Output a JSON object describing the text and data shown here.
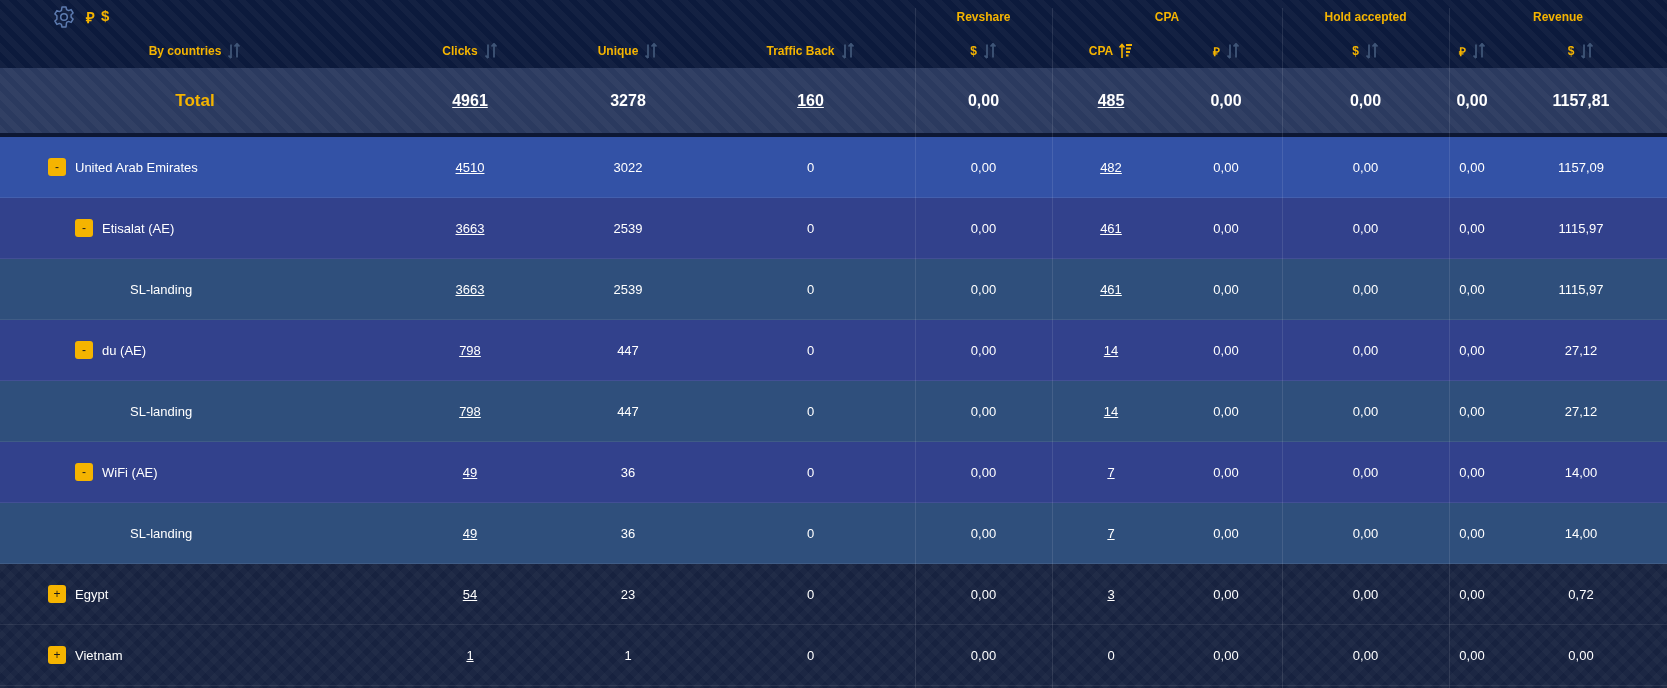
{
  "toolbar": {
    "currencies": [
      "₽",
      "$"
    ]
  },
  "columns": [
    {
      "label": "By countries",
      "sorted": false
    },
    {
      "label": "Clicks",
      "sorted": false
    },
    {
      "label": "Unique",
      "sorted": false
    },
    {
      "label": "Traffic Back",
      "sorted": false
    }
  ],
  "groups": [
    {
      "label": "Revshare",
      "columns": [
        {
          "label": "$",
          "sorted": false
        }
      ]
    },
    {
      "label": "CPA",
      "columns": [
        {
          "label": "CPA",
          "sorted": true
        },
        {
          "label": "₽",
          "sorted": false
        }
      ]
    },
    {
      "label": "Hold accepted",
      "columns": [
        {
          "label": "$",
          "sorted": false
        }
      ]
    },
    {
      "label": "Revenue",
      "columns": [
        {
          "label": "₽",
          "sorted": false
        },
        {
          "label": "$",
          "sorted": false
        }
      ]
    }
  ],
  "total": {
    "label": "Total",
    "cells": [
      {
        "text": "4961",
        "link": true
      },
      {
        "text": "3278",
        "link": false
      },
      {
        "text": "160",
        "link": true
      },
      {
        "text": "0,00",
        "link": false
      },
      {
        "text": "485",
        "link": true
      },
      {
        "text": "0,00",
        "link": false
      },
      {
        "text": "0,00",
        "link": false
      },
      {
        "text": "0,00",
        "link": false
      },
      {
        "text": "1157,81",
        "link": false
      }
    ]
  },
  "rows": [
    {
      "name": "United Arab Emirates",
      "toggle": "-",
      "expanded": true,
      "cells": [
        {
          "text": "4510",
          "link": true
        },
        {
          "text": "3022",
          "link": false
        },
        {
          "text": "0",
          "link": false
        },
        {
          "text": "0,00",
          "link": false
        },
        {
          "text": "482",
          "link": true
        },
        {
          "text": "0,00",
          "link": false
        },
        {
          "text": "0,00",
          "link": false
        },
        {
          "text": "0,00",
          "link": false
        },
        {
          "text": "1157,09",
          "link": false
        }
      ],
      "children": [
        {
          "name": "Etisalat (AE)",
          "toggle": "-",
          "expanded": true,
          "cells": [
            {
              "text": "3663",
              "link": true
            },
            {
              "text": "2539",
              "link": false
            },
            {
              "text": "0",
              "link": false
            },
            {
              "text": "0,00",
              "link": false
            },
            {
              "text": "461",
              "link": true
            },
            {
              "text": "0,00",
              "link": false
            },
            {
              "text": "0,00",
              "link": false
            },
            {
              "text": "0,00",
              "link": false
            },
            {
              "text": "1115,97",
              "link": false
            }
          ],
          "children": [
            {
              "name": "SL-landing",
              "cells": [
                {
                  "text": "3663",
                  "link": true
                },
                {
                  "text": "2539",
                  "link": false
                },
                {
                  "text": "0",
                  "link": false
                },
                {
                  "text": "0,00",
                  "link": false
                },
                {
                  "text": "461",
                  "link": true
                },
                {
                  "text": "0,00",
                  "link": false
                },
                {
                  "text": "0,00",
                  "link": false
                },
                {
                  "text": "0,00",
                  "link": false
                },
                {
                  "text": "1115,97",
                  "link": false
                }
              ]
            }
          ]
        },
        {
          "name": "du (AE)",
          "toggle": "-",
          "expanded": true,
          "cells": [
            {
              "text": "798",
              "link": true
            },
            {
              "text": "447",
              "link": false
            },
            {
              "text": "0",
              "link": false
            },
            {
              "text": "0,00",
              "link": false
            },
            {
              "text": "14",
              "link": true
            },
            {
              "text": "0,00",
              "link": false
            },
            {
              "text": "0,00",
              "link": false
            },
            {
              "text": "0,00",
              "link": false
            },
            {
              "text": "27,12",
              "link": false
            }
          ],
          "children": [
            {
              "name": "SL-landing",
              "cells": [
                {
                  "text": "798",
                  "link": true
                },
                {
                  "text": "447",
                  "link": false
                },
                {
                  "text": "0",
                  "link": false
                },
                {
                  "text": "0,00",
                  "link": false
                },
                {
                  "text": "14",
                  "link": true
                },
                {
                  "text": "0,00",
                  "link": false
                },
                {
                  "text": "0,00",
                  "link": false
                },
                {
                  "text": "0,00",
                  "link": false
                },
                {
                  "text": "27,12",
                  "link": false
                }
              ]
            }
          ]
        },
        {
          "name": "WiFi (AE)",
          "toggle": "-",
          "expanded": true,
          "cells": [
            {
              "text": "49",
              "link": true
            },
            {
              "text": "36",
              "link": false
            },
            {
              "text": "0",
              "link": false
            },
            {
              "text": "0,00",
              "link": false
            },
            {
              "text": "7",
              "link": true
            },
            {
              "text": "0,00",
              "link": false
            },
            {
              "text": "0,00",
              "link": false
            },
            {
              "text": "0,00",
              "link": false
            },
            {
              "text": "14,00",
              "link": false
            }
          ],
          "children": [
            {
              "name": "SL-landing",
              "cells": [
                {
                  "text": "49",
                  "link": true
                },
                {
                  "text": "36",
                  "link": false
                },
                {
                  "text": "0",
                  "link": false
                },
                {
                  "text": "0,00",
                  "link": false
                },
                {
                  "text": "7",
                  "link": true
                },
                {
                  "text": "0,00",
                  "link": false
                },
                {
                  "text": "0,00",
                  "link": false
                },
                {
                  "text": "0,00",
                  "link": false
                },
                {
                  "text": "14,00",
                  "link": false
                }
              ]
            }
          ]
        }
      ]
    },
    {
      "name": "Egypt",
      "toggle": "+",
      "expanded": false,
      "cells": [
        {
          "text": "54",
          "link": true
        },
        {
          "text": "23",
          "link": false
        },
        {
          "text": "0",
          "link": false
        },
        {
          "text": "0,00",
          "link": false
        },
        {
          "text": "3",
          "link": true
        },
        {
          "text": "0,00",
          "link": false
        },
        {
          "text": "0,00",
          "link": false
        },
        {
          "text": "0,00",
          "link": false
        },
        {
          "text": "0,72",
          "link": false
        }
      ]
    },
    {
      "name": "Vietnam",
      "toggle": "+",
      "expanded": false,
      "cells": [
        {
          "text": "1",
          "link": true
        },
        {
          "text": "1",
          "link": false
        },
        {
          "text": "0",
          "link": false
        },
        {
          "text": "0,00",
          "link": false
        },
        {
          "text": "0",
          "link": false
        },
        {
          "text": "0,00",
          "link": false
        },
        {
          "text": "0,00",
          "link": false
        },
        {
          "text": "0,00",
          "link": false
        },
        {
          "text": "0,00",
          "link": false
        }
      ]
    }
  ]
}
